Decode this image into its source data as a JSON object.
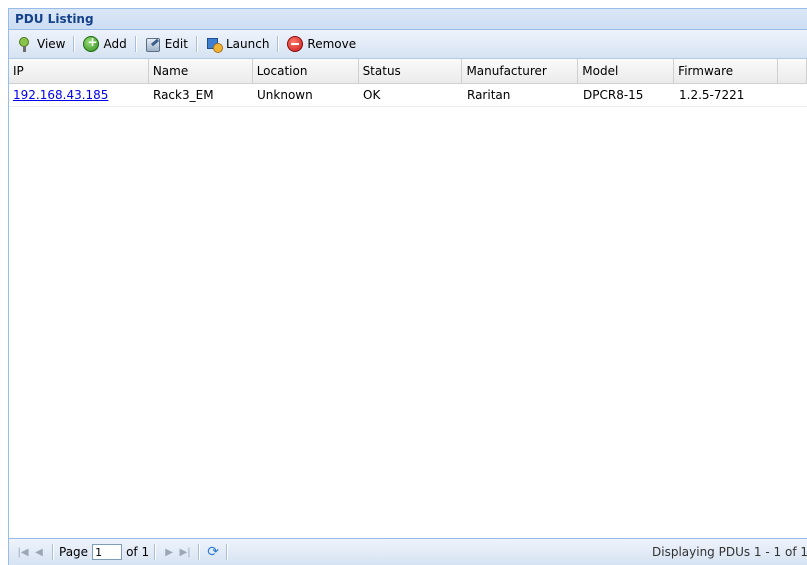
{
  "panel": {
    "title": "PDU Listing"
  },
  "toolbar": {
    "view_label": "View",
    "add_label": "Add",
    "edit_label": "Edit",
    "launch_label": "Launch",
    "remove_label": "Remove"
  },
  "grid": {
    "columns": [
      "IP",
      "Name",
      "Location",
      "Status",
      "Manufacturer",
      "Model",
      "Firmware"
    ],
    "rows": [
      {
        "ip": "192.168.43.185",
        "name": "Rack3_EM",
        "location": "Unknown",
        "status": "OK",
        "manufacturer": "Raritan",
        "model": "DPCR8-15",
        "firmware": "1.2.5-7221"
      }
    ]
  },
  "paging": {
    "page_label": "Page",
    "page_value": "1",
    "of_label": "of 1",
    "display_msg": "Displaying PDUs 1 - 1 of 1"
  },
  "colors": {
    "header_text": "#15428b",
    "border": "#99bbe8",
    "link": "#0000ee"
  }
}
